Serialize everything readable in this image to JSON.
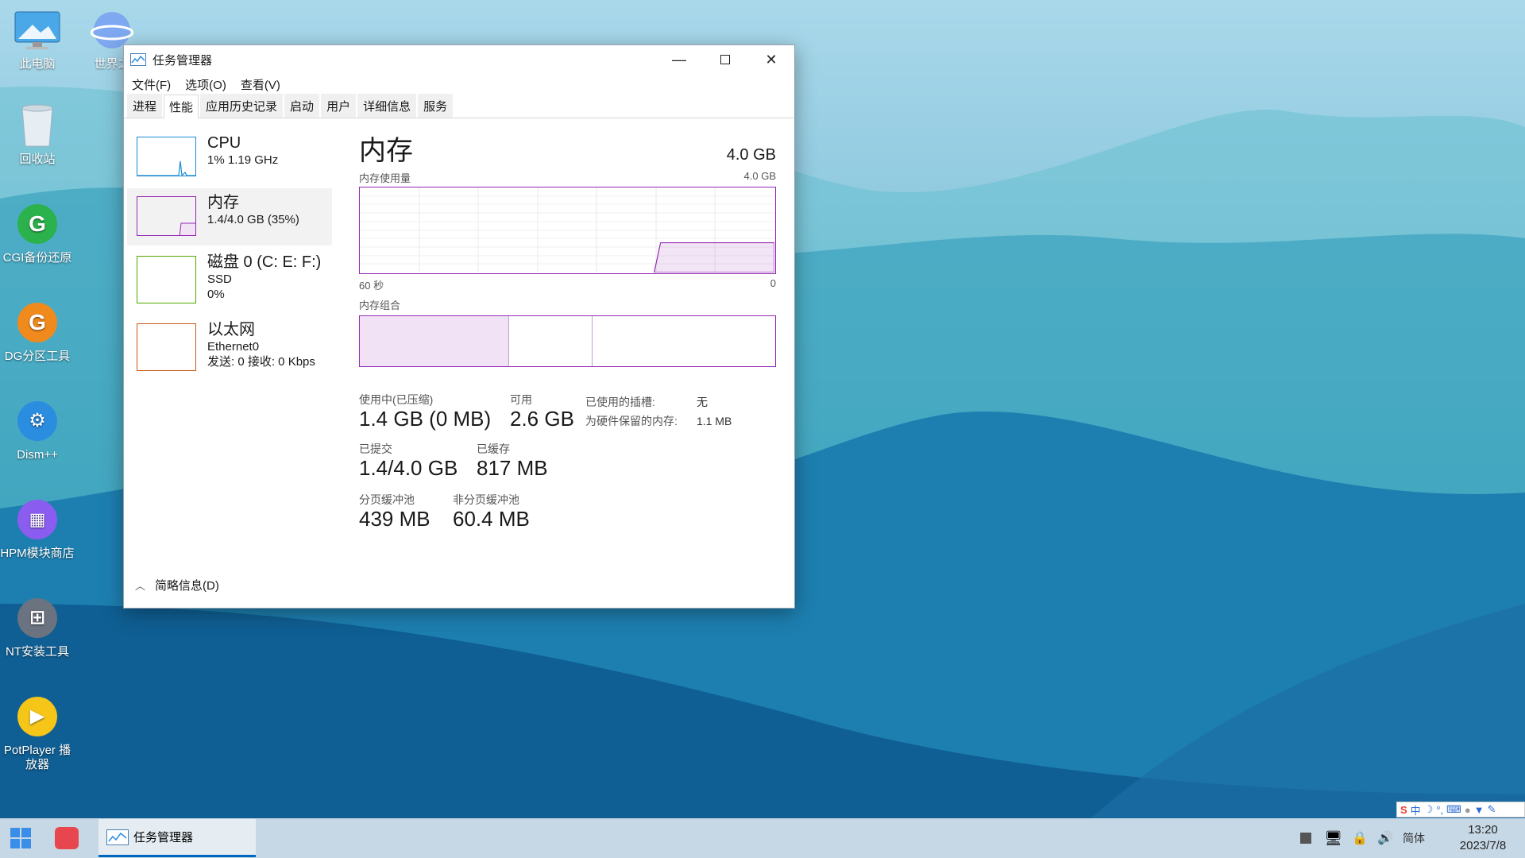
{
  "desktop": {
    "icons": [
      {
        "label": "此电脑"
      },
      {
        "label": "世界之"
      },
      {
        "label": "回收站"
      },
      {
        "label": "CGI备份还原"
      },
      {
        "label": "DG分区工具"
      },
      {
        "label": "Dism++"
      },
      {
        "label": "HPM模块商店"
      },
      {
        "label": "NT安装工具"
      },
      {
        "label": "PotPlayer 播放器"
      }
    ]
  },
  "window": {
    "title": "任务管理器",
    "menu": [
      "文件(F)",
      "选项(O)",
      "查看(V)"
    ],
    "tabs": [
      "进程",
      "性能",
      "应用历史记录",
      "启动",
      "用户",
      "详细信息",
      "服务"
    ],
    "active_tab": "性能",
    "sidebar": [
      {
        "title": "CPU",
        "sub1": "1% 1.19 GHz",
        "sub2": "",
        "color": "#1a8ad4"
      },
      {
        "title": "内存",
        "sub1": "1.4/4.0 GB (35%)",
        "sub2": "",
        "color": "#9528b4"
      },
      {
        "title": "磁盘 0 (C: E: F:)",
        "sub1": "SSD",
        "sub2": "0%",
        "color": "#4daa00"
      },
      {
        "title": "以太网",
        "sub1": "Ethernet0",
        "sub2": "发送: 0 接收: 0 Kbps",
        "color": "#cd5a12"
      }
    ],
    "memory": {
      "title": "内存",
      "total": "4.0 GB",
      "usage_label": "内存使用量",
      "usage_max": "4.0 GB",
      "time_left": "60 秒",
      "time_right": "0",
      "composition_label": "内存组合",
      "usage_fraction": 0.35,
      "composition": {
        "in_use_fraction": 0.36,
        "standby_end_fraction": 0.56
      },
      "stats": {
        "in_use_label": "使用中(已压缩)",
        "in_use_value": "1.4 GB (0 MB)",
        "available_label": "可用",
        "available_value": "2.6 GB",
        "slots_label": "已使用的插槽:",
        "slots_value": "无",
        "reserved_label": "为硬件保留的内存:",
        "reserved_value": "1.1 MB",
        "committed_label": "已提交",
        "committed_value": "1.4/4.0 GB",
        "cached_label": "已缓存",
        "cached_value": "817 MB",
        "paged_label": "分页缓冲池",
        "paged_value": "439 MB",
        "nonpaged_label": "非分页缓冲池",
        "nonpaged_value": "60.4 MB"
      }
    },
    "footer_label": "简略信息(D)"
  },
  "taskbar": {
    "running_app": "任务管理器",
    "ime_lang": "简体",
    "time": "13:20",
    "date": "2023/7/8",
    "ime_toolbar_mode": "中"
  }
}
